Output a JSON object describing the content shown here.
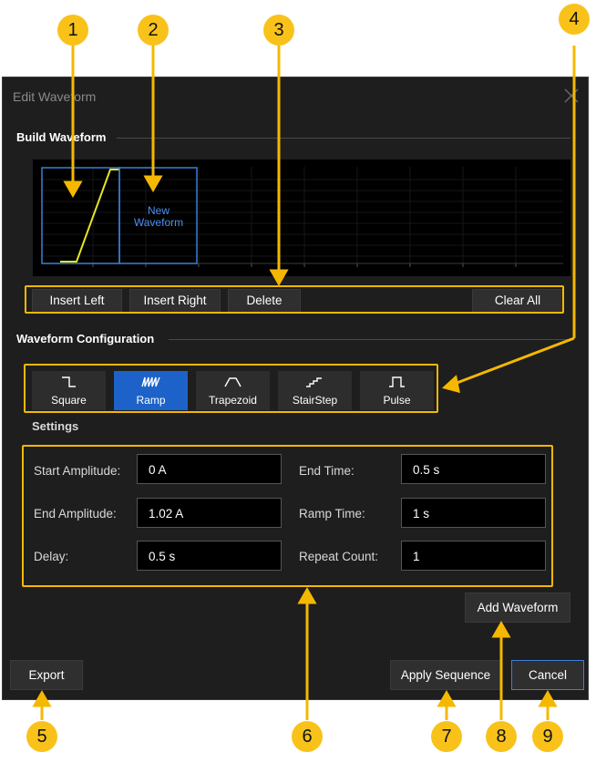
{
  "dialog": {
    "title": "Edit Waveform",
    "close_icon": "close-icon"
  },
  "build": {
    "title": "Build Waveform",
    "preview": {
      "new_waveform_label": "New Waveform"
    },
    "buttons": {
      "insert_left": "Insert Left",
      "insert_right": "Insert Right",
      "delete": "Delete",
      "clear_all": "Clear All"
    }
  },
  "config": {
    "title": "Waveform Configuration",
    "types": [
      {
        "label": "Square",
        "icon": "square-wave-icon"
      },
      {
        "label": "Ramp",
        "icon": "ramp-wave-icon",
        "selected": true
      },
      {
        "label": "Trapezoid",
        "icon": "trapezoid-wave-icon"
      },
      {
        "label": "StairStep",
        "icon": "stairstep-wave-icon"
      },
      {
        "label": "Pulse",
        "icon": "pulse-wave-icon"
      }
    ]
  },
  "settings": {
    "title": "Settings",
    "start_amplitude": {
      "label": "Start Amplitude:",
      "value": "0 A"
    },
    "end_amplitude": {
      "label": "End Amplitude:",
      "value": "1.02 A"
    },
    "delay": {
      "label": "Delay:",
      "value": "0.5 s"
    },
    "end_time": {
      "label": "End Time:",
      "value": "0.5 s"
    },
    "ramp_time": {
      "label": "Ramp Time:",
      "value": "1 s"
    },
    "repeat_count": {
      "label": "Repeat Count:",
      "value": "1"
    }
  },
  "actions": {
    "add_waveform": "Add Waveform",
    "export": "Export",
    "apply_sequence": "Apply Sequence",
    "cancel": "Cancel"
  },
  "callouts": [
    "1",
    "2",
    "3",
    "4",
    "5",
    "6",
    "7",
    "8",
    "9"
  ],
  "colors": {
    "callout": "#f9c21b",
    "highlight": "#f5b800",
    "selected": "#1d62c8",
    "ramp_trace": "#e6e620",
    "segment_border": "#3b7fd9"
  }
}
